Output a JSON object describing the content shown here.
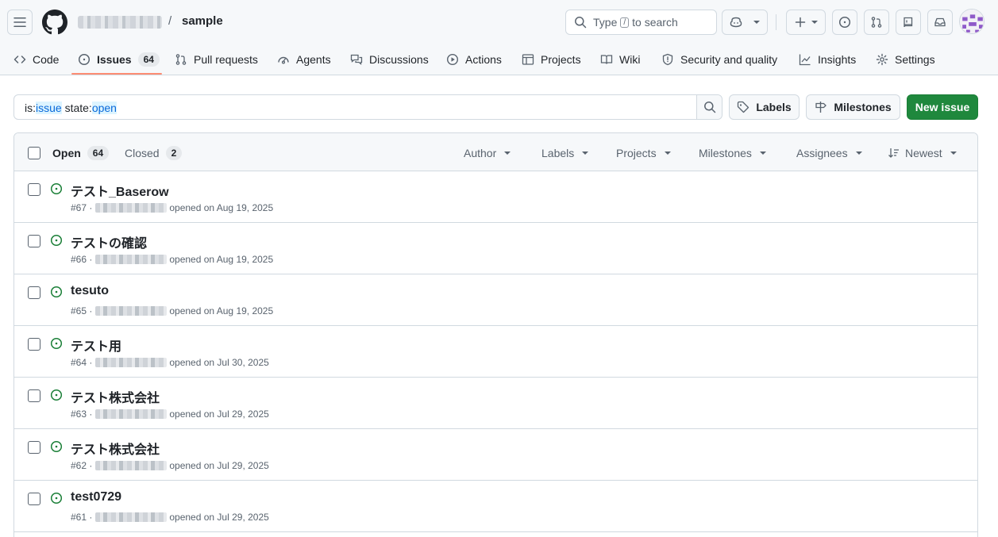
{
  "header": {
    "owner_hidden": "",
    "slash": "/",
    "repo": "sample",
    "search_prefix": "Type",
    "search_key": "/",
    "search_suffix": "to search"
  },
  "tabs": [
    {
      "label": "Code",
      "icon": "code-icon"
    },
    {
      "label": "Issues",
      "icon": "issue-opened-icon",
      "count": "64"
    },
    {
      "label": "Pull requests",
      "icon": "git-pull-request-icon"
    },
    {
      "label": "Agents",
      "icon": "agent-icon"
    },
    {
      "label": "Discussions",
      "icon": "comment-discussion-icon"
    },
    {
      "label": "Actions",
      "icon": "play-icon"
    },
    {
      "label": "Projects",
      "icon": "table-icon"
    },
    {
      "label": "Wiki",
      "icon": "book-icon"
    },
    {
      "label": "Security and quality",
      "icon": "shield-icon"
    },
    {
      "label": "Insights",
      "icon": "graph-icon"
    },
    {
      "label": "Settings",
      "icon": "gear-icon"
    }
  ],
  "filter": {
    "tok1_key": "is:",
    "tok1_val": "issue",
    "tok2_key": " state:",
    "tok2_val": "open"
  },
  "buttons": {
    "labels": "Labels",
    "milestones": "Milestones",
    "new_issue": "New issue"
  },
  "list_header": {
    "open_label": "Open",
    "open_count": "64",
    "closed_label": "Closed",
    "closed_count": "2",
    "sorts": [
      "Author",
      "Labels",
      "Projects",
      "Milestones",
      "Assignees",
      "Newest"
    ]
  },
  "issues": [
    {
      "title": "テスト_Baserow",
      "number": "#67 ·",
      "opened": "opened on Aug 19, 2025"
    },
    {
      "title": "テストの確認",
      "number": "#66 ·",
      "opened": "opened on Aug 19, 2025"
    },
    {
      "title": "tesuto",
      "number": "#65 ·",
      "opened": "opened on Aug 19, 2025"
    },
    {
      "title": "テスト用",
      "number": "#64 ·",
      "opened": "opened on Jul 30, 2025"
    },
    {
      "title": "テスト株式会社",
      "number": "#63 ·",
      "opened": "opened on Jul 29, 2025"
    },
    {
      "title": "テスト株式会社",
      "number": "#62 ·",
      "opened": "opened on Jul 29, 2025"
    },
    {
      "title": "test0729",
      "number": "#61 ·",
      "opened": "opened on Jul 29, 2025"
    }
  ],
  "colors": {
    "accent_green": "#1f883d",
    "open_icon": "#1a7f37",
    "tab_underline": "#fd8c73",
    "link_blue": "#0969da"
  }
}
